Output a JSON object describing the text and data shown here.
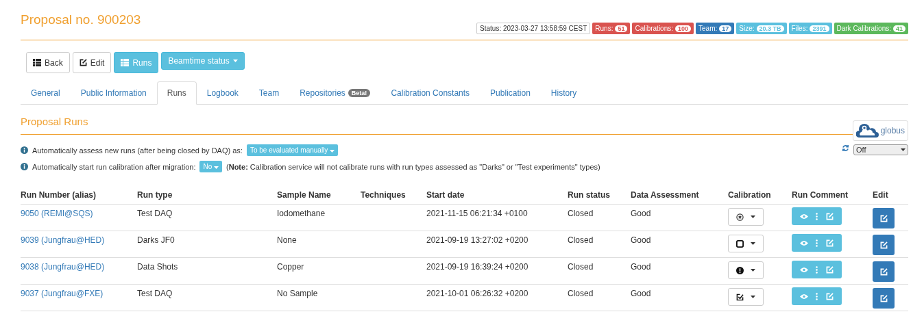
{
  "title": "Proposal no. 900203",
  "status": "Status: 2023-03-27 13:58:59 CEST",
  "counters": [
    {
      "label": "Runs:",
      "count": "51",
      "color": "#d9534f"
    },
    {
      "label": "Calibrations:",
      "count": "100",
      "color": "#d9534f"
    },
    {
      "label": "Team:",
      "count": "17",
      "color": "#337ab7"
    },
    {
      "label": "Size:",
      "count": "20.3 TB",
      "color": "#5bc0de"
    },
    {
      "label": "Files:",
      "count": "2391",
      "color": "#5bc0de"
    },
    {
      "label": "Dark Calibrations:",
      "count": "41",
      "color": "#5cb85c"
    }
  ],
  "buttons": [
    {
      "label": "Back",
      "kind": "list",
      "selected": false
    },
    {
      "label": "Edit",
      "kind": "edit",
      "selected": false
    },
    {
      "label": "Runs",
      "kind": "list",
      "selected": true
    }
  ],
  "beamtime_menu": {
    "label": "Beamtime status"
  },
  "tabs": [
    {
      "label": "General",
      "selected": false
    },
    {
      "label": "Public Information",
      "selected": false
    },
    {
      "label": "Runs",
      "selected": true
    },
    {
      "label": "Logbook",
      "selected": false
    },
    {
      "label": "Team",
      "selected": false
    },
    {
      "label": "Repositories",
      "badge": "Beta!",
      "selected": false
    },
    {
      "label": "Calibration Constants",
      "selected": false
    },
    {
      "label": "Publication",
      "selected": false
    },
    {
      "label": "History",
      "selected": false
    }
  ],
  "section_title": "Proposal Runs",
  "globus": {
    "label": "globus"
  },
  "refresh_select": {
    "value": "Off"
  },
  "settings": [
    {
      "text": "Automatically assess new runs (after being closed by DAQ) as:",
      "value": "To be evaluated manually"
    },
    {
      "text": "Automatically start run calibration after migration:",
      "value": "No",
      "note": "(**Note:** Calibration service will not calibrate runs with run types assessed as \"Darks\" or \"Test experiments\" types)"
    }
  ],
  "table": {
    "columns": [
      "Run Number (alias)",
      "Run type",
      "Sample Name",
      "Techniques",
      "Start date",
      "Run status",
      "Data Assessment",
      "Calibration",
      "Run Comment",
      "Edit"
    ],
    "rows": [
      {
        "run": "9050 (REMI@SQS)",
        "type": "Test DAQ",
        "sample": "Iodomethane",
        "start": "2021-11-15 06:21:34 +0100",
        "status": "Closed",
        "assessment": "Good",
        "calibration": {
          "kind": "error"
        }
      },
      {
        "run": "9039 (Jungfrau@HED)",
        "type": "Darks JF0",
        "sample": "None",
        "start": "2021-09-19 13:27:02 +0200",
        "status": "Closed",
        "assessment": "Good",
        "calibration": {
          "kind": "none"
        }
      },
      {
        "run": "9038 (Jungfrau@HED)",
        "type": "Data Shots",
        "sample": "Copper",
        "start": "2021-09-19 16:39:24 +0200",
        "status": "Closed",
        "assessment": "Good",
        "calibration": {
          "kind": "warning"
        }
      },
      {
        "run": "9037 (Jungfrau@FXE)",
        "type": "Test DAQ",
        "sample": "No Sample",
        "start": "2021-10-01 06:26:32 +0200",
        "status": "Closed",
        "assessment": "Good",
        "calibration": {
          "kind": "done"
        }
      }
    ]
  }
}
